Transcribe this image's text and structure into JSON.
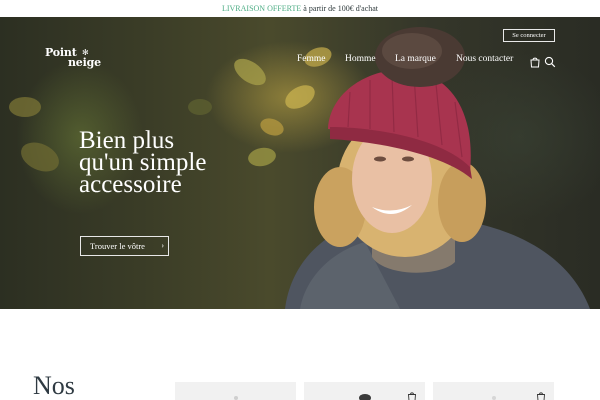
{
  "announcement": {
    "highlight": "LIVRAISON OFFERTE",
    "rest": " à partir de 100€ d'achat"
  },
  "logo": {
    "line1": "Point",
    "line2": "neige"
  },
  "header": {
    "login_label": "Se connecter",
    "nav": [
      {
        "label": "Femme"
      },
      {
        "label": "Homme"
      },
      {
        "label": "La marque"
      },
      {
        "label": "Nous contacter"
      }
    ]
  },
  "hero": {
    "headline": [
      "Bien plus",
      "qu'un simple",
      "accessoire"
    ],
    "cta_label": "Trouver le vôtre",
    "cta_icon": "chevron-right-icon"
  },
  "section": {
    "title": "Nos"
  },
  "colors": {
    "accent": "#4fae86",
    "text_dark": "#2f3a42",
    "hat": "#a8344f"
  },
  "icons": [
    "bag-icon",
    "search-icon",
    "snowflake-icon"
  ]
}
